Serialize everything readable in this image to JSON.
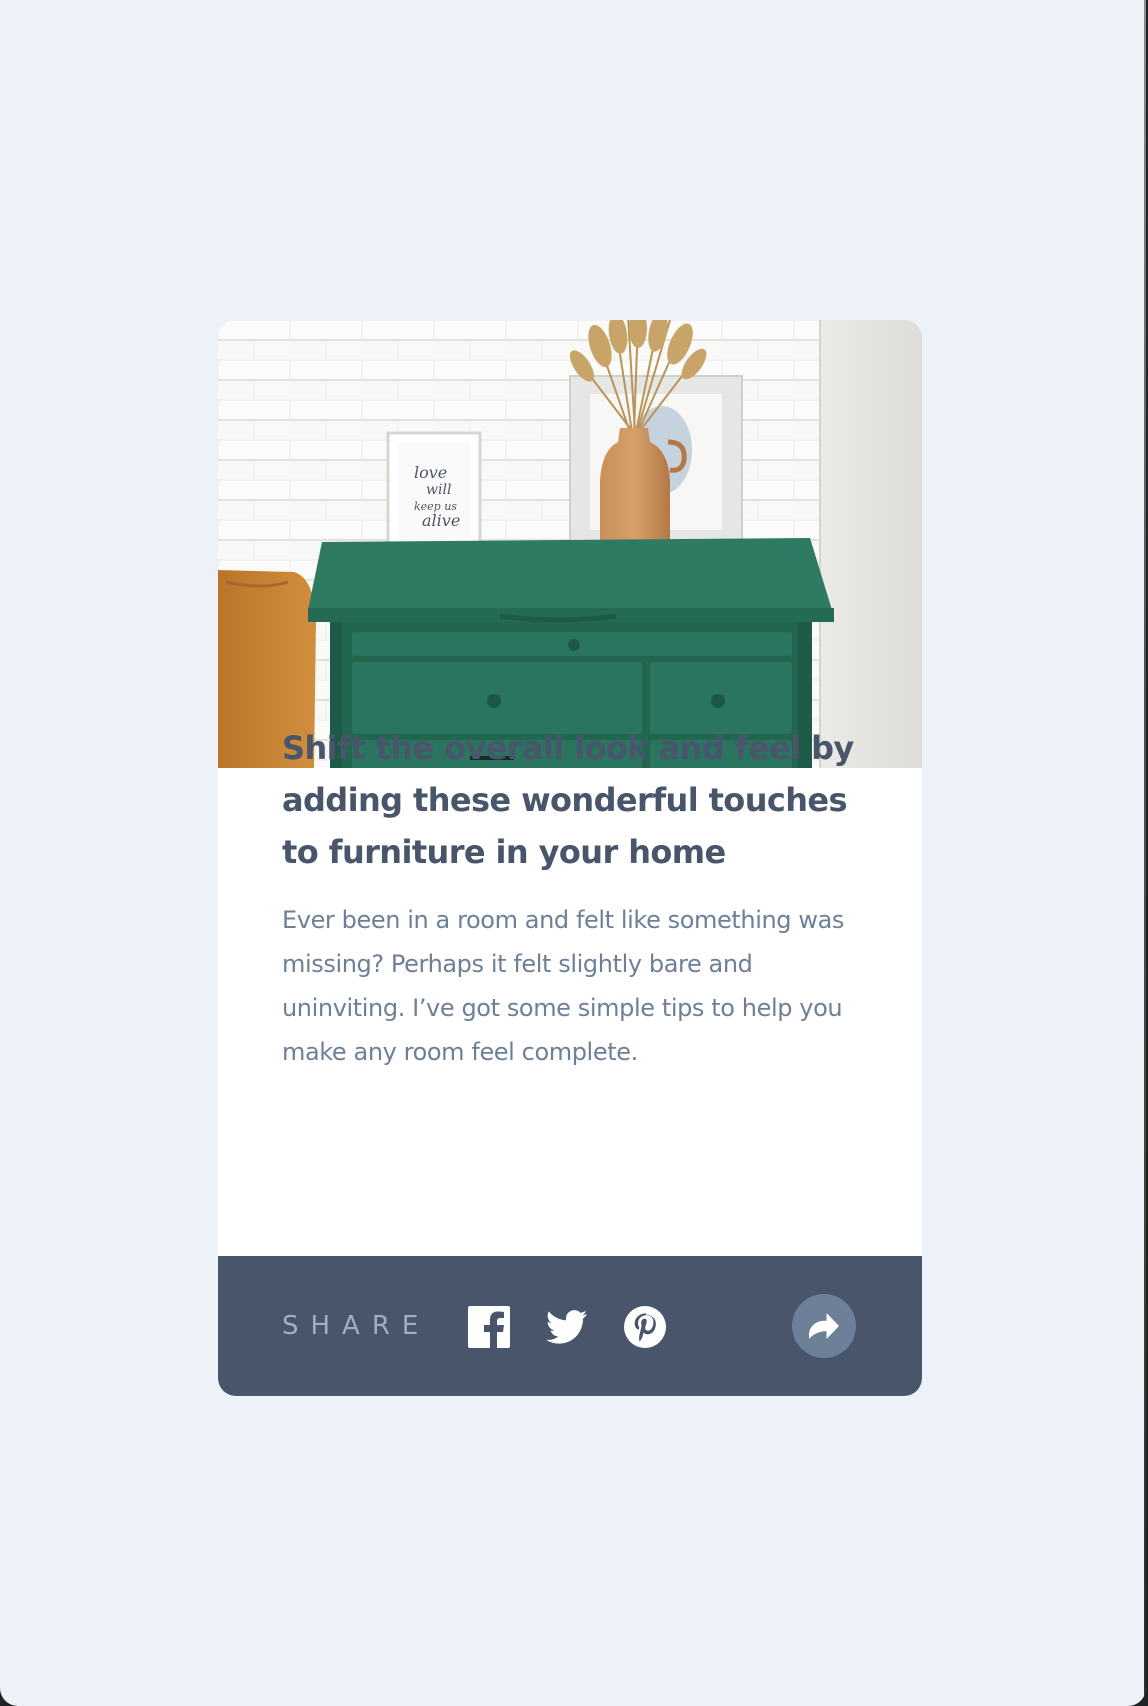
{
  "article": {
    "title": "Shift the overall look and feel by adding these wonderful touches to furniture in your home",
    "excerpt": "Ever been in a room and felt like something was missing? Perhaps it felt slightly bare and uninviting. I’ve got some simple tips to help you make any room feel complete.",
    "image_alt": "Green drawers",
    "framed_print_text": [
      "love",
      "will",
      "keep us",
      "alive"
    ]
  },
  "share": {
    "label": "SHARE",
    "icons": [
      "facebook-icon",
      "twitter-icon",
      "pinterest-icon",
      "share-arrow-icon"
    ]
  },
  "colors": {
    "page_background": "#ecf2f8",
    "card_background": "#ffffff",
    "title_text": "#48556a",
    "body_text": "#6e8098",
    "share_bar": "#48556a",
    "share_label": "#9eafc2",
    "share_button": "#6e8098"
  }
}
